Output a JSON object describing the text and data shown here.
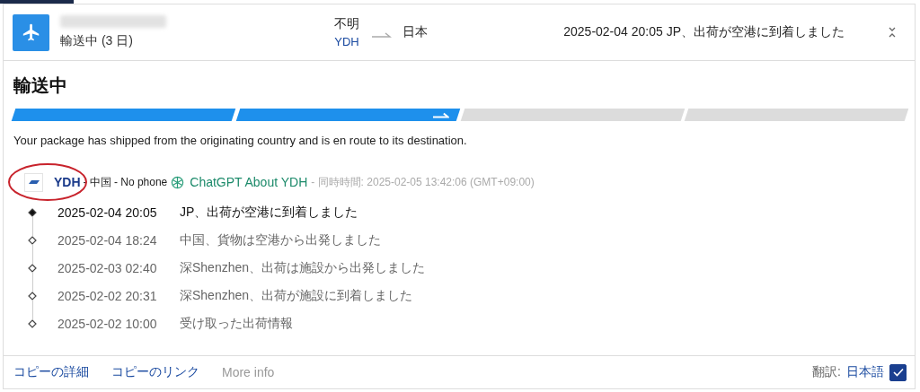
{
  "header": {
    "status": "輸送中 (3 日)",
    "origin": "不明",
    "carrier": "YDH",
    "destination": "日本",
    "latest": "2025-02-04 20:05 JP、出荷が空港に到着しました"
  },
  "title": "輸送中",
  "progress": [
    {
      "filled": true,
      "current": false
    },
    {
      "filled": true,
      "current": true
    },
    {
      "filled": false,
      "current": false
    },
    {
      "filled": false,
      "current": false
    }
  ],
  "description": "Your package has shipped from the originating country and is en route to its destination.",
  "carrier_row": {
    "name": "YDH",
    "country": "- 中国",
    "phone": "- No phone",
    "ai_link": "ChatGPT About YDH",
    "sync": "- 同時時間: 2025-02-05 13:42:06 (GMT+09:00)"
  },
  "events": [
    {
      "time": "2025-02-04 20:05",
      "text": "JP、出荷が空港に到着しました",
      "current": true
    },
    {
      "time": "2025-02-04 18:24",
      "text": "中国、貨物は空港から出発しました",
      "current": false
    },
    {
      "time": "2025-02-03 02:40",
      "text": "深Shenzhen、出荷は施設から出発しました",
      "current": false
    },
    {
      "time": "2025-02-02 20:31",
      "text": "深Shenzhen、出荷が施設に到着しました",
      "current": false
    },
    {
      "time": "2025-02-02 10:00",
      "text": "受け取った出荷情報",
      "current": false
    }
  ],
  "footer": {
    "links": [
      {
        "label": "コピーの詳細",
        "disabled": false
      },
      {
        "label": "コピーのリンク",
        "disabled": false
      },
      {
        "label": "More info",
        "disabled": true
      }
    ],
    "translate_label": "翻訳:",
    "language": "日本語",
    "translate_checked": true
  }
}
